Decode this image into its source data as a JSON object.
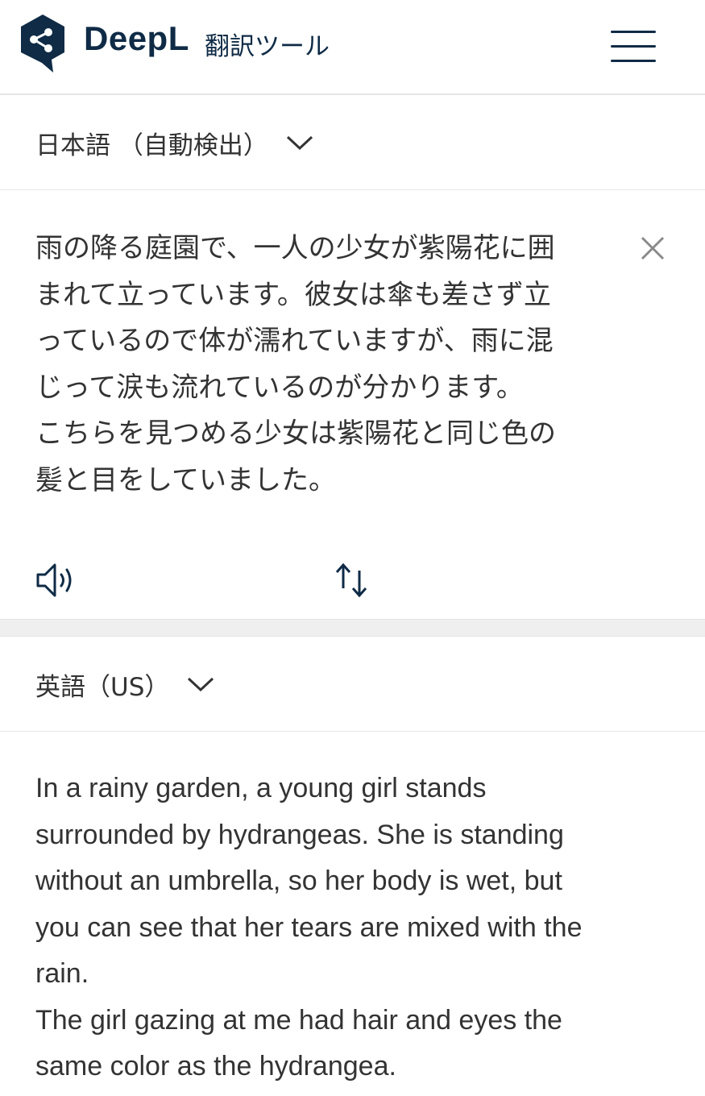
{
  "header": {
    "brand": "DeepL",
    "subtitle": "翻訳ツール"
  },
  "source": {
    "language": "日本語 （自動検出）",
    "text": "雨の降る庭園で、一人の少女が紫陽花に囲\nまれて立っています。彼女は傘も差さず立\nっているので体が濡れていますが、雨に混\nじって涙も流れているのが分かります。\nこちらを見つめる少女は紫陽花と同じ色の\n髪と目をしていました。"
  },
  "target": {
    "language": "英語（US）",
    "text": "In a rainy garden, a young girl stands\nsurrounded by hydrangeas. She is standing\nwithout an umbrella, so her body is wet, but\nyou can see that her tears are mixed with the\nrain.\nThe girl gazing at me had hair and eyes the\nsame color as the hydrangea."
  },
  "colors": {
    "brand_navy": "#0f2b46",
    "text": "#333333",
    "divider": "#efefef"
  },
  "icons": {
    "logo": "deepl-logo-icon",
    "menu": "hamburger-menu-icon",
    "chevron": "chevron-down-icon",
    "clear": "close-icon",
    "speaker": "speaker-icon",
    "swap": "swap-arrows-icon"
  }
}
